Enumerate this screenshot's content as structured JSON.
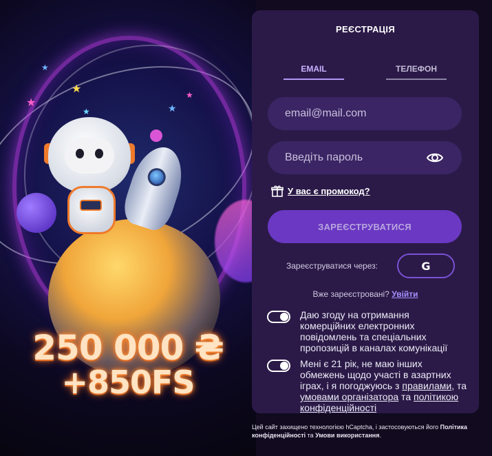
{
  "promo": {
    "bonus_amount": "250 000 ₴",
    "bonus_spins": "+850FS"
  },
  "form": {
    "title": "РЕЄСТРАЦІЯ",
    "tabs": [
      {
        "label": "EMAIL",
        "active": true
      },
      {
        "label": "ТЕЛЕФОН",
        "active": false
      }
    ],
    "email_placeholder": "email@mail.com",
    "password_placeholder": "Введіть пароль",
    "promo_link": "У вас є промокод?",
    "submit_label": "ЗАРЕЄСТРУВАТИСЯ",
    "social_label": "Зареєструватися через:",
    "google_icon_text": "G",
    "already_text": "Вже зареєстровані?",
    "login_link": "Увійти",
    "consents": [
      {
        "text": "Даю згоду на отримання комерційних електронних повідомлень та спеціальних пропозицій в каналах комунікації",
        "checked": true
      },
      {
        "text_before": "Мені є 21 рік, не маю інших обмежень щодо участі в азартних іграх, і я погоджуюсь з ",
        "link_rules": "правилами",
        "text_mid1": ", та ",
        "link_terms": "умовами організатора",
        "text_mid2": " та ",
        "link_policy": "політикою конфіденційності",
        "checked": true
      }
    ]
  },
  "captcha": {
    "text_before": "Цей сайт захищено технологією hCaptcha, і застосовуються його ",
    "privacy_link": "Політика конфіденційності",
    "and": " та ",
    "terms_link": "Умови використання",
    "end": "."
  },
  "colors": {
    "panel_bg": "#2b1a48",
    "field_bg": "#3b2564",
    "accent": "#6a38c2",
    "link": "#a690ff"
  }
}
